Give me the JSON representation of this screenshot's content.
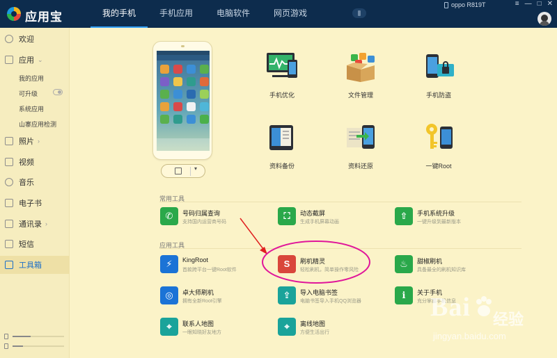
{
  "app": {
    "name": "应用宝"
  },
  "tabs": [
    {
      "label": "我的手机",
      "active": true
    },
    {
      "label": "手机应用",
      "active": false
    },
    {
      "label": "电脑软件",
      "active": false
    },
    {
      "label": "网页游戏",
      "active": false
    }
  ],
  "device": {
    "name": "oppo R819T"
  },
  "window_controls": {
    "menu": "≡",
    "minimize": "—",
    "maximize": "□",
    "close": "✕"
  },
  "sidebar": {
    "items": [
      {
        "label": "欢迎",
        "icon": "compass-icon"
      },
      {
        "label": "应用",
        "icon": "grid-icon",
        "arrow": "⌄"
      },
      {
        "label": "照片",
        "icon": "image-icon",
        "arrow": "›"
      },
      {
        "label": "视频",
        "icon": "video-icon"
      },
      {
        "label": "音乐",
        "icon": "music-icon"
      },
      {
        "label": "电子书",
        "icon": "book-icon"
      },
      {
        "label": "通讯录",
        "icon": "contacts-icon",
        "arrow": "›"
      },
      {
        "label": "短信",
        "icon": "message-icon"
      },
      {
        "label": "工具箱",
        "icon": "toolbox-icon",
        "active": true
      }
    ],
    "app_subitems": [
      "我的应用",
      "可升级",
      "系统应用",
      "山寨应用检测"
    ],
    "storage": {
      "phone_used": 0.35,
      "sd_used": 0.2
    }
  },
  "big_tools": [
    {
      "label": "手机优化",
      "icon": "phone-optimize-icon"
    },
    {
      "label": "文件管理",
      "icon": "file-manager-icon"
    },
    {
      "label": "手机防盗",
      "icon": "anti-theft-icon"
    },
    {
      "label": "资料备份",
      "icon": "backup-icon"
    },
    {
      "label": "资料还原",
      "icon": "restore-icon"
    },
    {
      "label": "一键Root",
      "icon": "root-key-icon"
    }
  ],
  "sections": {
    "common": "常用工具",
    "apps": "应用工具"
  },
  "common_tools": [
    {
      "name": "号码归属查询",
      "desc": "支持国内运营商号码",
      "color": "#2aa84a",
      "icon": "phone-lookup-icon"
    },
    {
      "name": "动态截屏",
      "desc": "生成手机屏幕动画",
      "color": "#2aa84a",
      "icon": "screenshot-icon"
    },
    {
      "name": "手机系统升级",
      "desc": "一键升级到最新版本",
      "color": "#2aa84a",
      "icon": "system-upgrade-icon"
    }
  ],
  "app_tools": [
    {
      "name": "KingRoot",
      "desc": "首款跨平台一键Root软件",
      "color": "#1b73d6",
      "icon": "kingroot-icon"
    },
    {
      "name": "刷机精灵",
      "desc": "轻松刷机，简单操作零风险",
      "color": "#d9463b",
      "icon": "flash-wizard-icon"
    },
    {
      "name": "甜椒刷机",
      "desc": "具备最全的刷机知识库",
      "color": "#2aa84a",
      "icon": "pepper-flash-icon"
    },
    {
      "name": "卓大师刷机",
      "desc": "拥有全新Root引擎",
      "color": "#1b73d6",
      "icon": "zhuo-master-icon"
    },
    {
      "name": "导入电脑书签",
      "desc": "电脑书签导入手机QQ浏览器",
      "color": "#1aa39a",
      "icon": "bookmark-import-icon"
    },
    {
      "name": "关于手机",
      "desc": "充分掌握手机信息",
      "color": "#2aa84a",
      "icon": "about-phone-icon"
    },
    {
      "name": "联系人地图",
      "desc": "一眼知晓好友地方",
      "color": "#1aa39a",
      "icon": "contact-map-icon"
    },
    {
      "name": "离线地图",
      "desc": "方便生活出行",
      "color": "#1aa39a",
      "icon": "offline-map-icon"
    }
  ],
  "watermark": {
    "brand": "Bai",
    "brand_cn": "经验",
    "url": "jingyan.baidu.com"
  },
  "colors": {
    "titlebar": "#0d2c4d",
    "background": "#fbf3c8",
    "accent": "#1b6ec8",
    "annotation": "#e0169a",
    "arrow": "#e02020"
  }
}
